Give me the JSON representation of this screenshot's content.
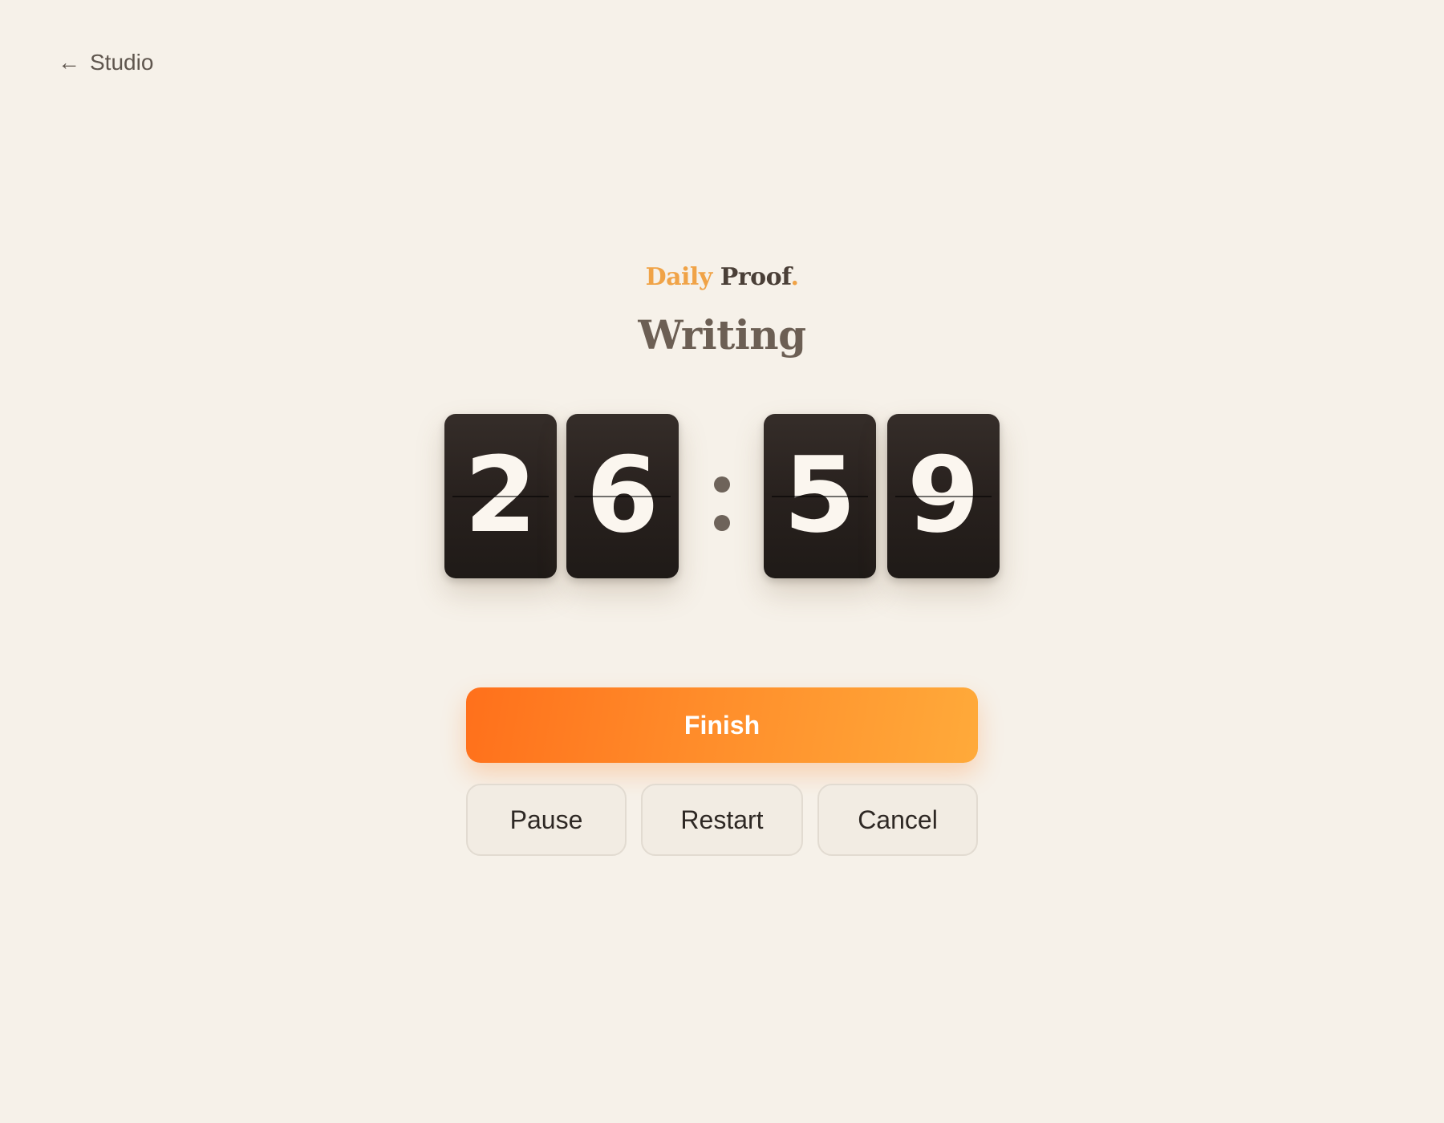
{
  "nav": {
    "back_arrow": "←",
    "back_label": "Studio"
  },
  "brand": {
    "word1": "Daily",
    "word2": "Proof",
    "punct": "."
  },
  "session": {
    "title": "Writing"
  },
  "timer": {
    "digits": [
      "2",
      "6",
      "5",
      "9"
    ],
    "minutes": "26",
    "seconds": "59"
  },
  "actions": {
    "finish_label": "Finish",
    "pause_label": "Pause",
    "restart_label": "Restart",
    "cancel_label": "Cancel"
  },
  "colors": {
    "accent": "#ff8c2a",
    "background": "#f6f1e9",
    "tile": "#28211e"
  }
}
